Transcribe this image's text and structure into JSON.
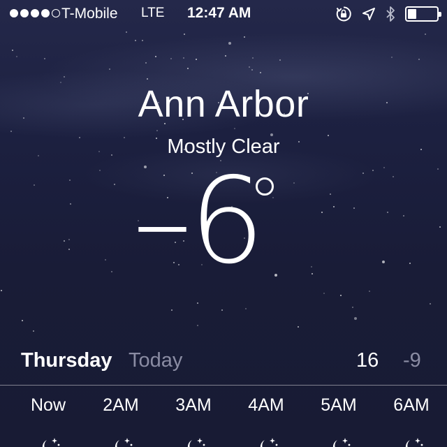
{
  "status_bar": {
    "carrier": "T-Mobile",
    "network": "LTE",
    "time": "12:47 AM",
    "signal_bars": 4,
    "signal_max": 5,
    "battery_level": 0.3,
    "icons": [
      "rotation-lock-icon",
      "location-icon",
      "bluetooth-icon",
      "battery-icon"
    ]
  },
  "weather": {
    "city": "Ann Arbor",
    "condition": "Mostly Clear",
    "temperature": "-6"
  },
  "today": {
    "day": "Thursday",
    "label": "Today",
    "high": "16",
    "low": "-9"
  },
  "hourly": [
    {
      "label": "Now",
      "icon": "moon-stars-icon"
    },
    {
      "label": "2AM",
      "icon": "moon-stars-icon"
    },
    {
      "label": "3AM",
      "icon": "moon-stars-icon"
    },
    {
      "label": "4AM",
      "icon": "moon-stars-icon"
    },
    {
      "label": "5AM",
      "icon": "moon-stars-icon"
    },
    {
      "label": "6AM",
      "icon": "moon-stars-icon"
    }
  ],
  "colors": {
    "background_top": "#24284a",
    "background_bottom": "#181b34",
    "text_primary": "#ffffff",
    "text_secondary": "#8a8ca3"
  }
}
